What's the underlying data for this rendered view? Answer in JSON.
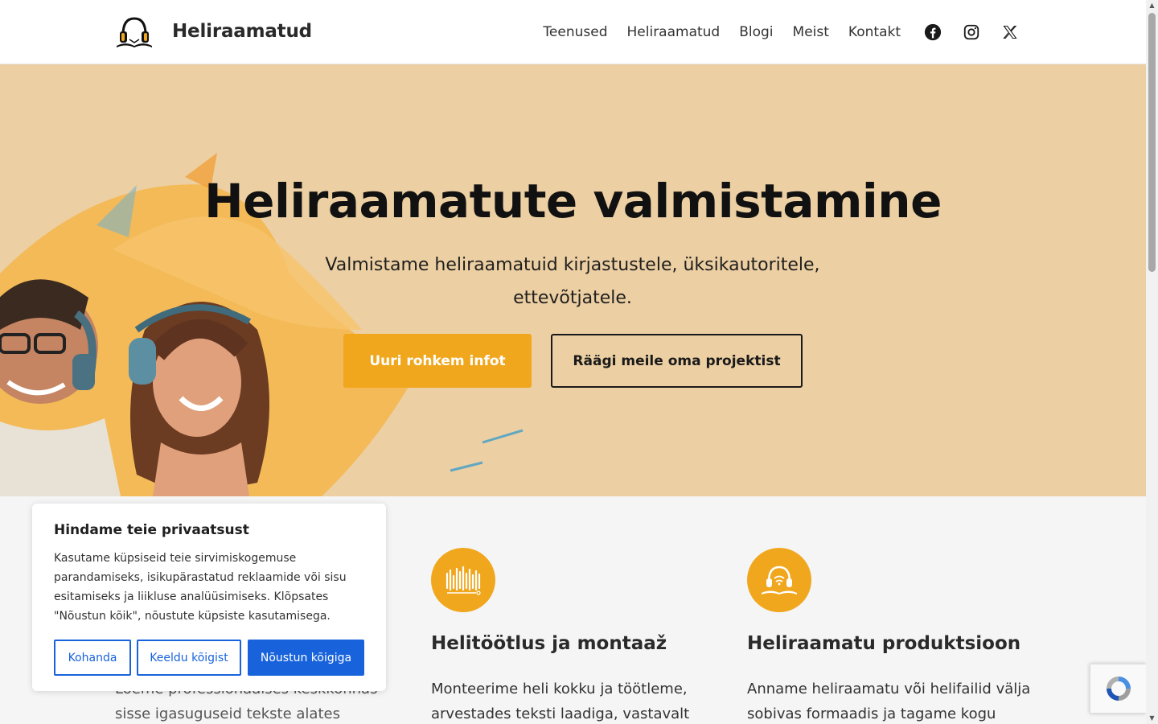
{
  "header": {
    "brand": "Heliraamatud",
    "nav": [
      "Teenused",
      "Heliraamatud",
      "Blogi",
      "Meist",
      "Kontakt"
    ],
    "social_icons": [
      "facebook-icon",
      "instagram-icon",
      "x-icon"
    ]
  },
  "hero": {
    "title": "Heliraamatute valmistamine",
    "subtitle": "Valmistame heliraamatuid kirjastustele, üksikautoritele, ettevõtjatele.",
    "primary_button": "Uuri rohkem infot",
    "secondary_button": "Räägi meile oma projektist"
  },
  "features": [
    {
      "icon": "",
      "title": "",
      "text": "Loeme professionaalses keskkonnas sisse igasuguseid tekste alates"
    },
    {
      "icon": "audio-waveform-icon",
      "title": "Helitöötlus ja montaaž",
      "text": "Monteerime heli kokku ja töötleme, arvestades teksti laadiga, vastavalt"
    },
    {
      "icon": "headphones-book-icon",
      "title": "Heliraamatu produktsioon",
      "text": "Anname heliraamatu või helifailid välja sobivas formaadis ja tagame kogu"
    }
  ],
  "cookie_banner": {
    "title": "Hindame teie privaatsust",
    "text": "Kasutame küpsiseid teie sirvimiskogemuse parandamiseks, isikupärastatud reklaamide või sisu esitamiseks ja liikluse analüüsimiseks. Klõpsates \"Nõustun kõik\", nõustute küpsiste kasutamisega.",
    "customize": "Kohanda",
    "reject": "Keeldu kõigist",
    "accept": "Nõustun kõigiga"
  },
  "colors": {
    "accent": "#f0a71d",
    "hero_bg": "#eccfa2",
    "cookie_blue": "#1863dc"
  }
}
